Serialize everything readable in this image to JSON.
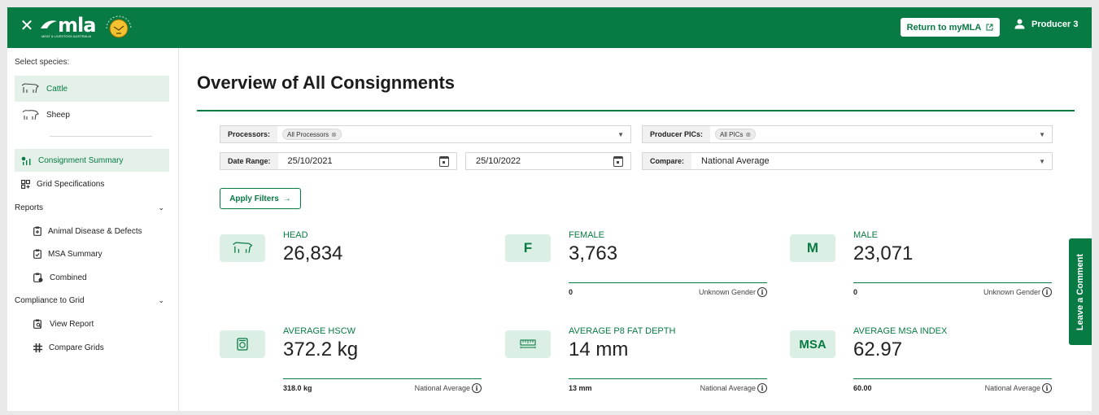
{
  "header": {
    "logo_text": "mla",
    "logo_sub": "MEAT & LIVESTOCK AUSTRALIA",
    "feedback_text": "MYFEEDBACK",
    "return_label": "Return to myMLA",
    "user_label": "Producer 3",
    "brand_color": "#087a43"
  },
  "sidebar": {
    "species_label": "Select species:",
    "species": [
      {
        "label": "Cattle",
        "icon": "cow-icon"
      },
      {
        "label": "Sheep",
        "icon": "sheep-icon"
      }
    ],
    "nav": {
      "consignment_summary": "Consignment Summary",
      "grid_specifications": "Grid Specifications",
      "reports": "Reports",
      "animal_disease": "Animal Disease & Defects",
      "msa_summary": "MSA Summary",
      "combined": "Combined",
      "compliance": "Compliance to Grid",
      "view_report": "View Report",
      "compare_grids": "Compare Grids"
    }
  },
  "main": {
    "title": "Overview of All Consignments",
    "filters": {
      "processors_label": "Processors:",
      "processors_chip": "All Processors",
      "pics_label": "Producer PICs:",
      "pics_chip": "All PICs",
      "date_label": "Date Range:",
      "date_from": "25/10/2021",
      "date_to": "25/10/2022",
      "compare_label": "Compare:",
      "compare_value": "National Average",
      "apply_label": "Apply Filters"
    },
    "stats": [
      {
        "icon_text": "",
        "icon": "cow-icon",
        "label": "HEAD",
        "value": "26,834",
        "foot_left": "",
        "foot_right": ""
      },
      {
        "icon_text": "F",
        "label": "FEMALE",
        "value": "3,763",
        "foot_left": "0",
        "foot_right": "Unknown Gender"
      },
      {
        "icon_text": "M",
        "label": "MALE",
        "value": "23,071",
        "foot_left": "0",
        "foot_right": "Unknown Gender"
      },
      {
        "icon_text": "",
        "icon": "scale-icon",
        "label": "AVERAGE HSCW",
        "value": "372.2 kg",
        "foot_left": "318.0 kg",
        "foot_right": "National Average"
      },
      {
        "icon_text": "",
        "icon": "ruler-icon",
        "label": "AVERAGE P8 FAT DEPTH",
        "value": "14 mm",
        "foot_left": "13 mm",
        "foot_right": "National Average"
      },
      {
        "icon_text": "MSA",
        "label": "AVERAGE MSA INDEX",
        "value": "62.97",
        "foot_left": "60.00",
        "foot_right": "National Average"
      }
    ],
    "leave_comment": "Leave a Comment"
  }
}
